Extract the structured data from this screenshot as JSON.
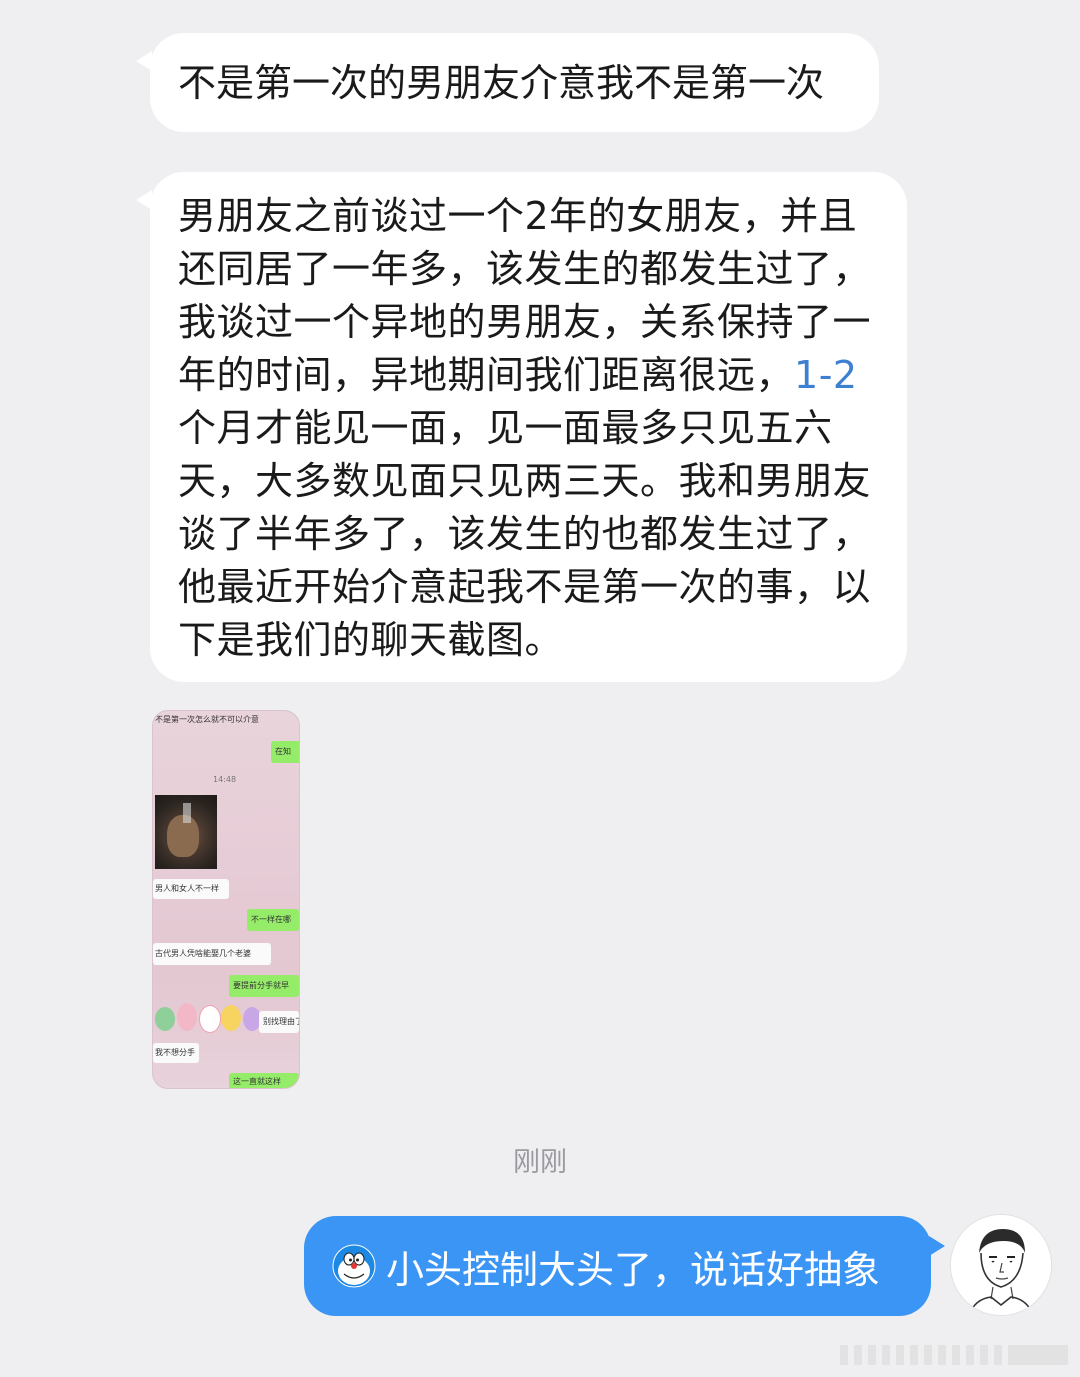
{
  "messages": {
    "title_text": "不是第一次的男朋友介意我不是第一次",
    "body_part1": "男朋友之前谈过一个2年的女朋友，并且还同居了一年多，该发生的都发生过了，我谈过一个异地的男朋友，关系保持了一年的时间，异地期间我们距离很远，",
    "body_link": "1-2",
    "body_part2": "个月才能见一面，见一面最多只见五六天，大多数见面只见两三天。我和男朋友谈了半年多了，该发生的也都发生过了，他最近开始介意起我不是第一次的事，以下是我们的聊天截图。",
    "thumbnail": {
      "line1": "不是第一次怎么就不可以介意",
      "green1": "在知",
      "time": "14:48",
      "line2": "男人和女人不一样",
      "green2": "不一样在哪",
      "line3": "古代男人凭啥能娶几个老婆",
      "green3": "要提前分手就早",
      "green4": "别找理由了",
      "line4": "我不想分手",
      "green5": "这一直就这样"
    },
    "timestamp": "刚刚",
    "reply_text": "小头控制大头了，说话好抽象"
  },
  "icons": {
    "reply_emoji": "doraemon-icon",
    "avatar": "avatar-sketch-icon"
  },
  "colors": {
    "background": "#efeff1",
    "bubble_left": "#ffffff",
    "bubble_right": "#3b95f5",
    "link": "#3d7fd1",
    "timestamp": "#9a9aa0"
  }
}
